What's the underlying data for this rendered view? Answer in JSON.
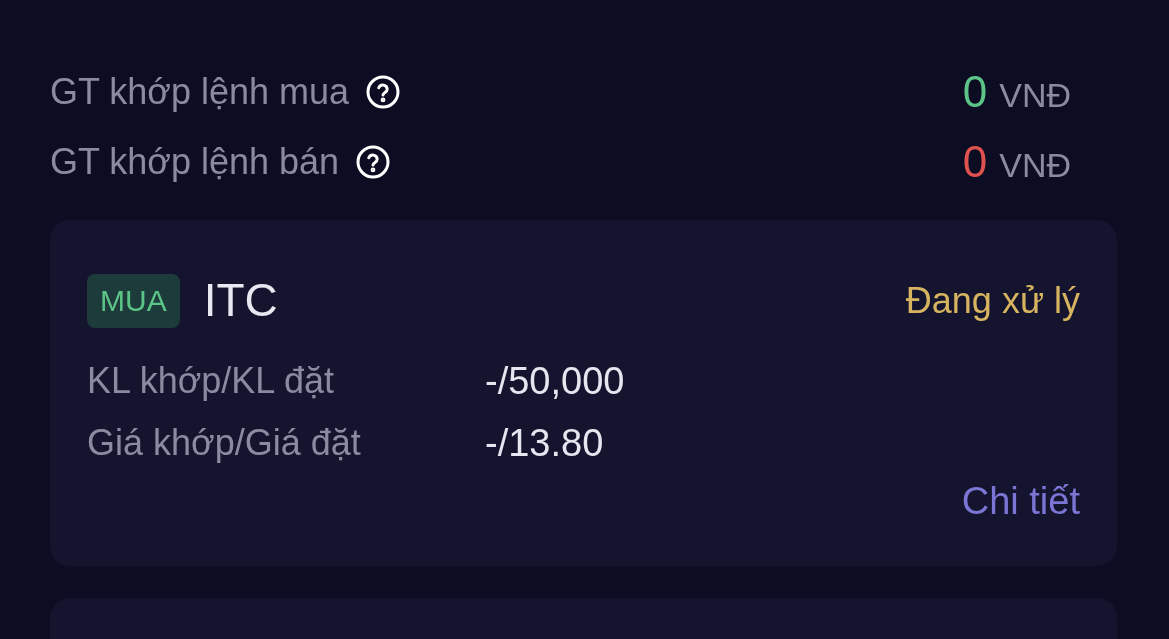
{
  "summary": [
    {
      "label": "GT khớp lệnh mua",
      "value": "0",
      "color": "#5cc487",
      "unit": "VNĐ"
    },
    {
      "label": "GT khớp lệnh bán",
      "value": "0",
      "color": "#e0524f",
      "unit": "VNĐ"
    }
  ],
  "orders": [
    {
      "side": {
        "label": "MUA",
        "kind": "buy"
      },
      "symbol": "ITC",
      "status": "Đang xử lý",
      "fields": [
        {
          "label": "KL khớp/KL đặt",
          "value": "-/50,000"
        },
        {
          "label": "Giá khớp/Giá đặt",
          "value": "-/13.80"
        }
      ],
      "link": "Chi tiết"
    }
  ]
}
